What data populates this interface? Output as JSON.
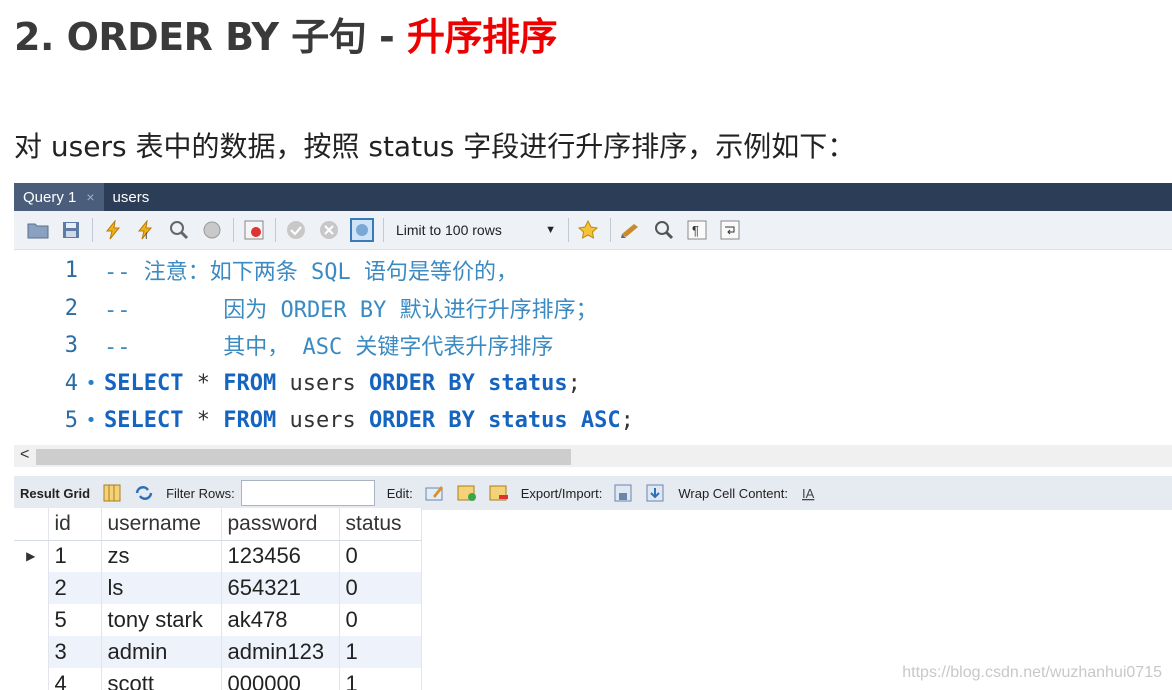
{
  "heading": {
    "prefix": "2. ORDER BY 子句 - ",
    "highlight": "升序排序"
  },
  "intro": "对 users 表中的数据，按照 status 字段进行升序排序，示例如下：",
  "tabs": [
    {
      "label": "Query 1",
      "close": "×"
    },
    {
      "label": "users"
    }
  ],
  "toolbar": {
    "limit_label": "Limit to 100 rows"
  },
  "editor": {
    "lines": [
      {
        "num": "1",
        "dot": "",
        "parts": [
          {
            "t": "-- 注意：如下两条 SQL 语句是等价的，",
            "c": "cmt"
          }
        ]
      },
      {
        "num": "2",
        "dot": "",
        "parts": [
          {
            "t": "--       因为 ORDER BY 默认进行升序排序；",
            "c": "cmt"
          }
        ]
      },
      {
        "num": "3",
        "dot": "",
        "parts": [
          {
            "t": "--       其中， ASC 关键字代表升序排序",
            "c": "cmt"
          }
        ]
      },
      {
        "num": "4",
        "dot": "•",
        "parts": [
          {
            "t": "SELECT",
            "c": "kw"
          },
          {
            "t": " * ",
            "c": "tx"
          },
          {
            "t": "FROM",
            "c": "kw"
          },
          {
            "t": " users ",
            "c": "tx"
          },
          {
            "t": "ORDER BY",
            "c": "kw"
          },
          {
            "t": " ",
            "c": "tx"
          },
          {
            "t": "status",
            "c": "kw"
          },
          {
            "t": ";",
            "c": "tx"
          }
        ]
      },
      {
        "num": "5",
        "dot": "•",
        "parts": [
          {
            "t": "SELECT",
            "c": "kw"
          },
          {
            "t": " * ",
            "c": "tx"
          },
          {
            "t": "FROM",
            "c": "kw"
          },
          {
            "t": " users ",
            "c": "tx"
          },
          {
            "t": "ORDER BY",
            "c": "kw"
          },
          {
            "t": " ",
            "c": "tx"
          },
          {
            "t": "status ASC",
            "c": "kw"
          },
          {
            "t": ";",
            "c": "tx"
          }
        ]
      }
    ]
  },
  "scroll_arrow": "<",
  "result_toolbar": {
    "result_grid": "Result Grid",
    "filter_rows": "Filter Rows:",
    "edit": "Edit:",
    "export_import": "Export/Import:",
    "wrap_cell": "Wrap Cell Content:"
  },
  "grid": {
    "columns": [
      "id",
      "username",
      "password",
      "status"
    ],
    "rows": [
      [
        "1",
        "zs",
        "123456",
        "0"
      ],
      [
        "2",
        "ls",
        "654321",
        "0"
      ],
      [
        "5",
        "tony stark",
        "ak478",
        "0"
      ],
      [
        "3",
        "admin",
        "admin123",
        "1"
      ],
      [
        "4",
        "scott",
        "000000",
        "1"
      ]
    ]
  },
  "watermark": "https://blog.csdn.net/wuzhanhui0715"
}
